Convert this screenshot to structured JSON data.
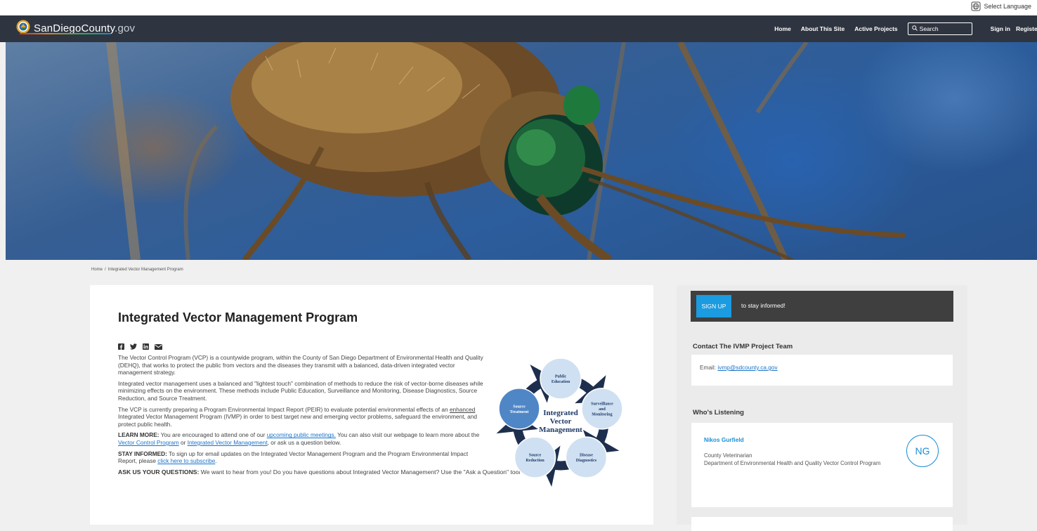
{
  "topbar": {
    "language_label": "Select Language",
    "language_icon": "globe-icon"
  },
  "navbar": {
    "logo_text_main": "SanDiegoCounty",
    "logo_text_suffix": ".gov",
    "logo_icon": "county-seal-icon",
    "links": [
      "Home",
      "About This Site",
      "Active Projects"
    ],
    "search_placeholder": "Search",
    "search_icon": "search-icon",
    "sign_in": "Sign in",
    "register": "Register"
  },
  "hero": {
    "image_subject": "mosquito macro photo"
  },
  "breadcrumb": {
    "home": "Home",
    "separator": "/",
    "current": "Integrated Vector Management Program"
  },
  "main": {
    "title": "Integrated Vector Management Program",
    "share_icons": [
      "facebook-icon",
      "twitter-icon",
      "linkedin-icon",
      "email-icon"
    ],
    "p1": "The Vector Control Program (VCP) is a countywide program, within the County of San Diego Department of Environmental Health and Quality (DEHQ), that works to protect the public from vectors and the diseases they transmit with a balanced, data-driven integrated vector management strategy.",
    "p2": "Integrated vector management uses a balanced and \"lightest touch\" combination of methods to reduce the risk of vector-borne diseases while minimizing effects on the environment. These methods include Public Education, Surveillance and Monitoring, Disease Diagnostics, Source Reduction, and Source Treatment.",
    "p3_a": "The VCP is currently preparing a Program Environmental Impact Report (PEIR) to evaluate potential environmental effects of an ",
    "p3_u": "enhanced",
    "p3_b": " Integrated Vector Management Program (IVMP) in order to best target new and emerging vector problems, safeguard the environment, and protect public health.",
    "learn_label": "LEARN MORE:",
    "learn_a": " You are encouraged to attend one of our ",
    "learn_link1": "upcoming public meetings.",
    "learn_b": " You can also visit our webpage to learn more about the ",
    "learn_link2": "Vector Control Program",
    "learn_c": " or ",
    "learn_link3": "Integrated Vector Management",
    "learn_d": ", or ask us a question below.",
    "stay_label": "STAY INFORMED:",
    "stay_a": " To sign up for email updates on the Integrated Vector Management Program and the Program Environmental Impact Report, please ",
    "stay_link": "click here to subscribe",
    "stay_b": ".",
    "ask_label": "ASK US YOUR QUESTIONS:",
    "ask_text": " We want to hear from you! Do you have questions about Integrated Vector Management? Use the \"Ask a Question\" tool below."
  },
  "diagram": {
    "center_lines": [
      "Integrated",
      "Vector",
      "Management"
    ],
    "nodes": [
      {
        "lines": [
          "Public",
          "Education"
        ]
      },
      {
        "lines": [
          "Surveillance",
          "and",
          "Monitoring"
        ]
      },
      {
        "lines": [
          "Disease",
          "Diagnostics"
        ]
      },
      {
        "lines": [
          "Source",
          "Reduction"
        ]
      },
      {
        "lines": [
          "Source",
          "Treatment"
        ]
      }
    ],
    "colors": {
      "node_light": "#cfe0f2",
      "node_dark": "#4f86c6",
      "arrow": "#1e2f4e",
      "center_text": "#1e3a66"
    }
  },
  "sidebar": {
    "signup_button": "SIGN UP",
    "signup_text": "to stay informed!",
    "contact_title": "Contact The IVMP Project Team",
    "contact_email_label": "Email: ",
    "contact_email": "ivmp@sdcounty.ca.gov",
    "listening_title": "Who's Listening",
    "listener": {
      "name": "Nikos Gurfield",
      "role_line1": "County Veterinarian",
      "role_line2": "Department of Environmental Health and Quality Vector Control Program",
      "initials": "NG"
    }
  },
  "colors": {
    "navbar": "#2f3540",
    "accent_blue": "#1b9be0",
    "link": "#1a73c9",
    "signup_bar": "#3f3f3f"
  }
}
